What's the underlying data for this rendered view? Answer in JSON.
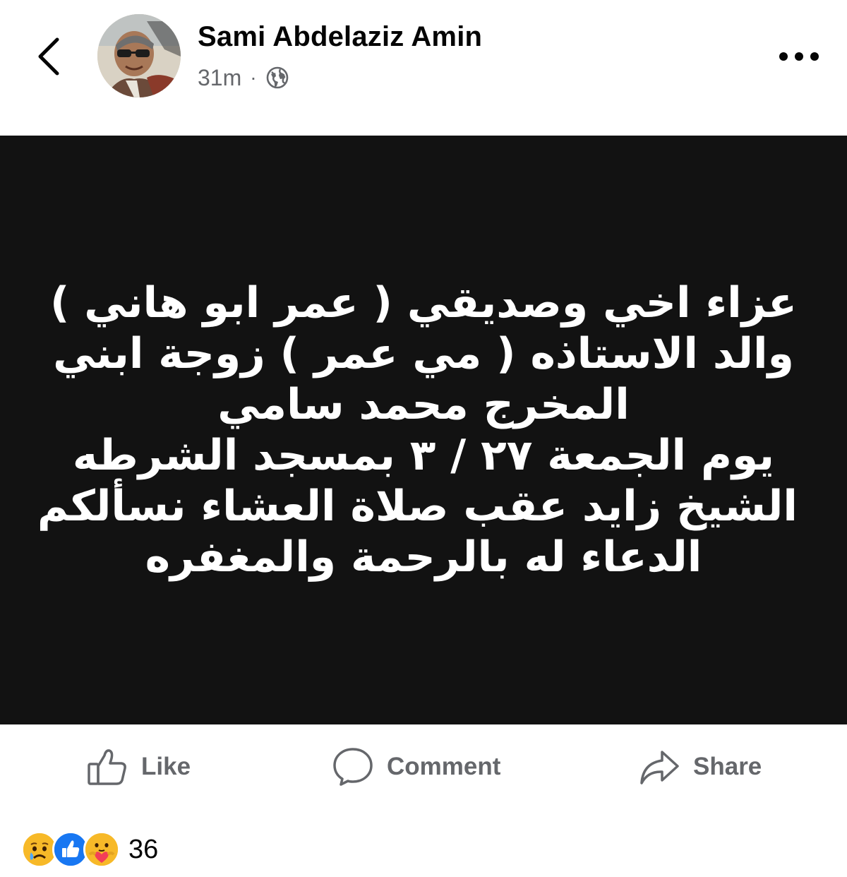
{
  "post": {
    "author_name": "Sami Abdelaziz Amin",
    "timestamp": "31m",
    "separator": "·",
    "privacy_icon": "globe-icon",
    "image_text_lines": [
      "عزاء اخي وصديقي ( عمر ابو هاني )",
      "والد الاستاذه (  مي عمر  ) زوجة ابني",
      "المخرج محمد سامي",
      "يوم  الجمعة ٢٧ / ٣ بمسجد الشرطه",
      "الشيخ زايد  عقب صلاة العشاء نسألكم",
      "الدعاء  له بالرحمة والمغفره"
    ]
  },
  "header": {
    "back_icon": "chevron-left-icon",
    "more_icon": "more-dots-icon"
  },
  "actions": {
    "like_label": "Like",
    "comment_label": "Comment",
    "share_label": "Share"
  },
  "reactions": {
    "types": [
      "sad",
      "like",
      "care"
    ],
    "count": "36"
  },
  "colors": {
    "image_background": "#121212",
    "secondary_text": "#65676b",
    "like_blue": "#1877f2",
    "reaction_yellow": "#f7b928"
  }
}
